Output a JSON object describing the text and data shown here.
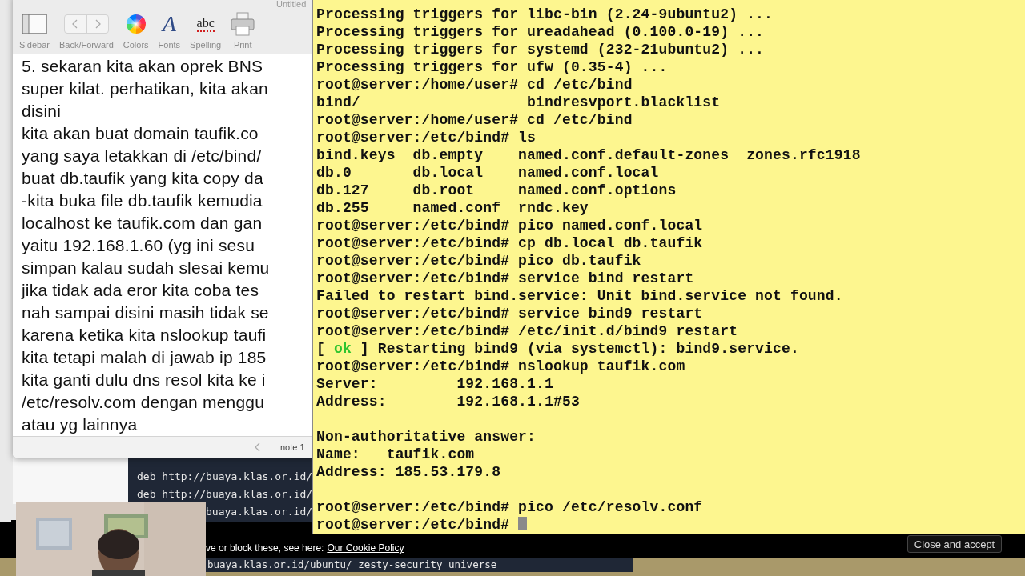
{
  "text_editor": {
    "title": "Untitled",
    "toolbar": [
      {
        "kind": "sidebar",
        "label": "Sidebar"
      },
      {
        "kind": "back_forward",
        "label": "Back/Forward"
      },
      {
        "kind": "colors",
        "label": "Colors"
      },
      {
        "kind": "fonts",
        "label": "Fonts",
        "glyph": "A"
      },
      {
        "kind": "spelling",
        "label": "Spelling",
        "glyph": "abc"
      },
      {
        "kind": "print",
        "label": "Print"
      }
    ],
    "lines": [
      "5. sekaran kita akan oprek BNS",
      "super kilat. perhatikan, kita akan",
      "disini",
      "kita akan buat domain taufik.co",
      "yang saya letakkan di /etc/bind/",
      "buat db.taufik yang kita copy da",
      "-kita buka file db.taufik kemudia",
      "localhost ke taufik.com dan gan",
      "yaitu 192.168.1.60 (yg ini sesu",
      "simpan kalau sudah slesai kemu",
      "jika tidak ada eror kita coba tes",
      "nah sampai disini masih tidak se",
      "karena ketika kita nslookup taufi",
      "kita tetapi malah di jawab ip 185",
      "kita ganti dulu dns resol kita ke i",
      "/etc/resolv.com dengan menggu",
      "atau yg lainnya"
    ],
    "status_label": "note 1"
  },
  "browser": {
    "code_lines": [
      "deb http://buaya.klas.or.id/",
      "deb http://buaya.klas.or.id/",
      "buaya.klas.or.id/"
    ],
    "cookie_banner": {
      "text": "ve or block these, see here:",
      "link": "Our Cookie Policy",
      "button": "Close and accept"
    },
    "bottom_code_line": "buaya.klas.or.id/ubuntu/ zesty-security universe"
  },
  "terminal": {
    "lines": [
      {
        "kind": "text",
        "text": "Processing triggers for libc-bin (2.24-9ubuntu2) ..."
      },
      {
        "kind": "text",
        "text": "Processing triggers for ureadahead (0.100.0-19) ..."
      },
      {
        "kind": "text",
        "text": "Processing triggers for systemd (232-21ubuntu2) ..."
      },
      {
        "kind": "text",
        "text": "Processing triggers for ufw (0.35-4) ..."
      },
      {
        "kind": "text",
        "text": "root@server:/home/user# cd /etc/bind"
      },
      {
        "kind": "text",
        "text": "bind/                   bindresvport.blacklist"
      },
      {
        "kind": "text",
        "text": "root@server:/home/user# cd /etc/bind"
      },
      {
        "kind": "text",
        "text": "root@server:/etc/bind# ls"
      },
      {
        "kind": "text",
        "text": "bind.keys  db.empty    named.conf.default-zones  zones.rfc1918"
      },
      {
        "kind": "text",
        "text": "db.0       db.local    named.conf.local"
      },
      {
        "kind": "text",
        "text": "db.127     db.root     named.conf.options"
      },
      {
        "kind": "text",
        "text": "db.255     named.conf  rndc.key"
      },
      {
        "kind": "text",
        "text": "root@server:/etc/bind# pico named.conf.local"
      },
      {
        "kind": "text",
        "text": "root@server:/etc/bind# cp db.local db.taufik"
      },
      {
        "kind": "text",
        "text": "root@server:/etc/bind# pico db.taufik"
      },
      {
        "kind": "text",
        "text": "root@server:/etc/bind# service bind restart"
      },
      {
        "kind": "text",
        "text": "Failed to restart bind.service: Unit bind.service not found."
      },
      {
        "kind": "text",
        "text": "root@server:/etc/bind# service bind9 restart"
      },
      {
        "kind": "text",
        "text": "root@server:/etc/bind# /etc/init.d/bind9 restart"
      },
      {
        "kind": "status",
        "before": "[ ",
        "status": "ok",
        "after": " ] Restarting bind9 (via systemctl): bind9.service."
      },
      {
        "kind": "text",
        "text": "root@server:/etc/bind# nslookup taufik.com"
      },
      {
        "kind": "text",
        "text": "Server:         192.168.1.1"
      },
      {
        "kind": "text",
        "text": "Address:        192.168.1.1#53"
      },
      {
        "kind": "blank"
      },
      {
        "kind": "text",
        "text": "Non-authoritative answer:"
      },
      {
        "kind": "text",
        "text": "Name:   taufik.com"
      },
      {
        "kind": "text",
        "text": "Address: 185.53.179.8"
      },
      {
        "kind": "blank"
      },
      {
        "kind": "text",
        "text": "root@server:/etc/bind# pico /etc/resolv.conf"
      },
      {
        "kind": "text",
        "text": "root@server:/etc/bind# ",
        "cursor": true
      }
    ]
  }
}
